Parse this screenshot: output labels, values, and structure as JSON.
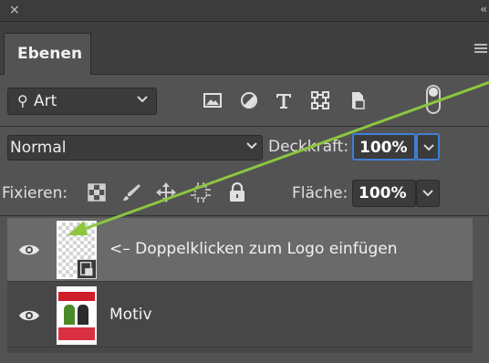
{
  "panel": {
    "tab_label": "Ebenen",
    "colors": {
      "background": "#535353",
      "selected_row": "#6a6a6a",
      "focus": "#3f7fd8",
      "annotation_arrow": "#8cc63f"
    }
  },
  "filter": {
    "kind_label": "Art",
    "icons": [
      "image-filter-icon",
      "adjustment-filter-icon",
      "type-filter-icon",
      "shape-filter-icon",
      "smartobject-filter-icon"
    ],
    "toggle_icon": "filter-toggle-icon"
  },
  "blend": {
    "mode": "Normal",
    "opacity_label": "Deckkraft:",
    "opacity_value": "100%"
  },
  "lock": {
    "label": "Fixieren:",
    "icons": [
      "lock-transparent-pixels-icon",
      "lock-image-pixels-icon",
      "lock-position-icon",
      "lock-artboard-icon",
      "lock-all-icon"
    ],
    "fill_label": "Fläche:",
    "fill_value": "100%"
  },
  "layers": [
    {
      "name": "<– Doppelklicken zum Logo einfügen",
      "visible": true,
      "selected": true,
      "kind": "smart-object"
    },
    {
      "name": "Motiv",
      "visible": true,
      "selected": false,
      "kind": "image"
    }
  ]
}
